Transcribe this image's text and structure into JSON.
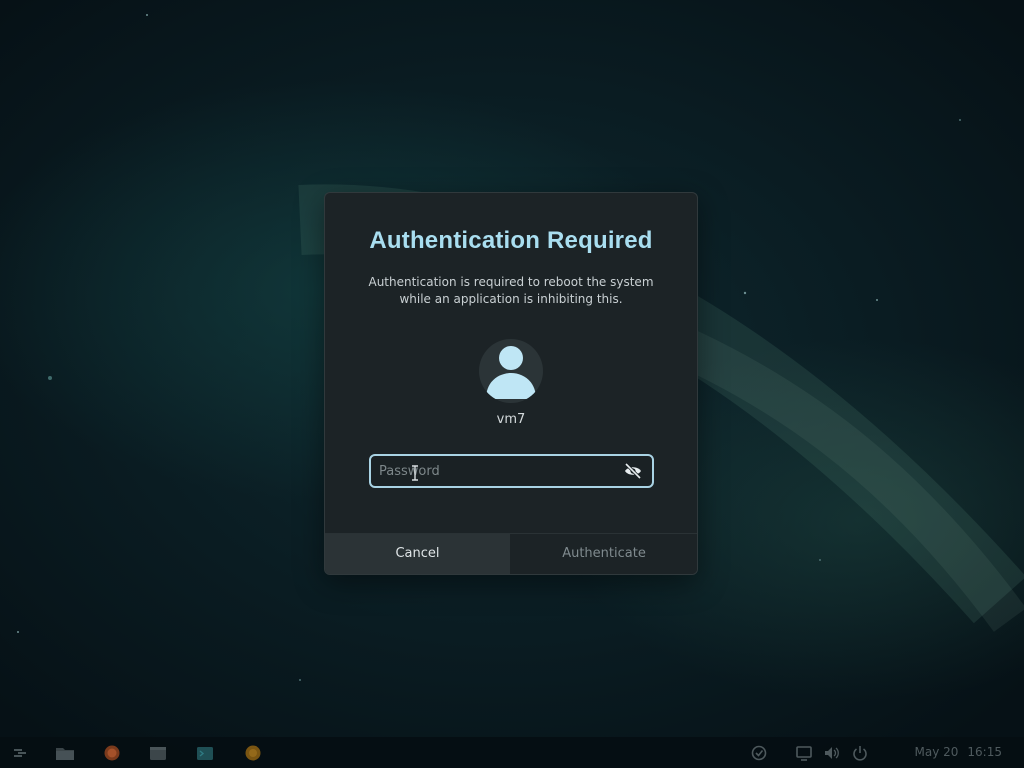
{
  "dialog": {
    "title": "Authentication Required",
    "description": "Authentication is required to reboot the system while an application is inhibiting this.",
    "user": {
      "name": "vm7",
      "avatar_icon": "user-avatar-icon"
    },
    "password": {
      "value": "",
      "placeholder": "Password",
      "visibility_icon": "eye-slash-icon"
    },
    "buttons": {
      "cancel": "Cancel",
      "authenticate": "Authenticate"
    }
  },
  "taskbar": {
    "launchers": [
      "menu-icon",
      "folder-icon",
      "firefox-icon",
      "files-icon",
      "terminal-icon",
      "app-icon"
    ],
    "tray": [
      "updates-icon",
      "display-icon",
      "volume-icon",
      "power-icon"
    ],
    "date": "May 20",
    "time": "16:15"
  },
  "colors": {
    "accent": "#a9def0",
    "dialog_bg": "#1c2326",
    "cancel_bg": "#2b3336",
    "focus_border": "#a9d3e4"
  }
}
